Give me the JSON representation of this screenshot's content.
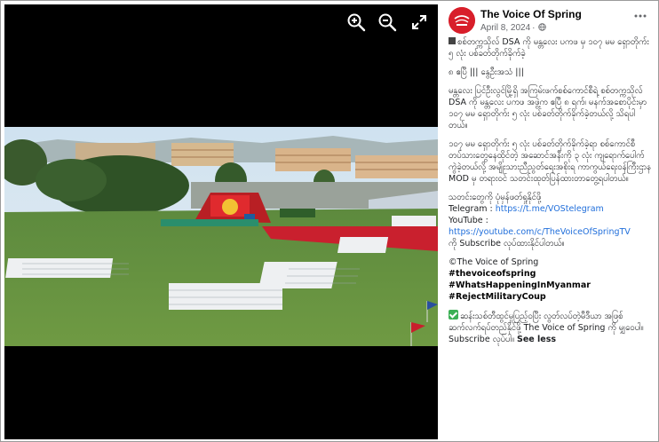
{
  "viewer": {
    "controls": [
      {
        "name": "zoom-in",
        "label": "Zoom in"
      },
      {
        "name": "zoom-out",
        "label": "Zoom out"
      },
      {
        "name": "fullscreen",
        "label": "Enter full screen"
      }
    ]
  },
  "post": {
    "page_name": "The Voice Of Spring",
    "date": "April 8, 2024",
    "headline": "စစ်တက္ကသိုလ် DSA ကို မန္တလေး ပကဖ မှ ၁၀၇ မမ ရှောတိုက်း ၅ လုံး ပစ်ခတ်တိုက်ခိုက်ခဲ့",
    "dateline": "၈ ဧပြီ ||| နွေဦးအသံ |||",
    "paragraph1": "မန္တလေး ပြင်ဦးလွင်မြို့ရှိ အကြမ်းဖက်စစ်ကောင်စီရဲ့ စစ်တက္ကသိုလ် DSA ကို မန္တလေး ပကဖ အဖွဲ့က ဧပြီ ၈ ရက်၊ မနက်အစောပိုင်းမှာ ၁၀၇ မမ ရှောတိုက်း ၅ လုံး ပစ်ခတ်တိုက်ခိုက်ခဲ့တယ်လို့ သိရပါတယ်။",
    "paragraph2": "၁၀၇ မမ ရှောတိုက်း ၅ လုံး ပစ်ခတ်တိုက်ခိုက်ခဲ့ရာ စစ်ကောင်စီတပ်သားတွေနေထိုင်တဲ့ အဆောင်အနီးကို ၃ လုံး ကျရောက်ပေါက်ကွဲခဲ့တယ်လို့ အမျိုးသားညီညွတ်ရေးအစိုးရ ကာကွယ်ရေးဝန်ကြီးဌာန MOD မှ တရားဝင် သတင်းထုတ်ပြန်ထားတာတွေ့ရပါတယ်။",
    "news_follow": "သတင်းတွေကို ပုံမှန်ဖတ်ရှုနိုင်ဖို့",
    "telegram_label": "Telegram : ",
    "telegram_url": "https://t.me/VOStelegram",
    "youtube_label": "YouTube :",
    "youtube_url": "https://youtube.com/c/TheVoiceOfSpringTV",
    "youtube_suffix": "ကို Subscribe လုပ်ထားနိုင်ပါတယ်။",
    "copyright": "©The Voice of Spring",
    "hashtags": [
      "#thevoiceofspring",
      "#WhatsHappeningInMyanmar",
      "#RejectMilitaryCoup"
    ],
    "footer": "ဆန်းသစ်တီထွင်မှုပြည့်ဝပြီး လွတ်လပ်တဲ့မီဒီယာ အဖြစ် ဆက်လက်ရပ်တည်နိုင်ဖို့ The Voice of Spring ကို မျှဝေပါ။ Subscribe လုပ်ပါ။",
    "see_less": "See less"
  },
  "colors": {
    "avatar_red": "#d81e2a",
    "link_blue": "#216fdb",
    "meta_gray": "#65676b"
  }
}
